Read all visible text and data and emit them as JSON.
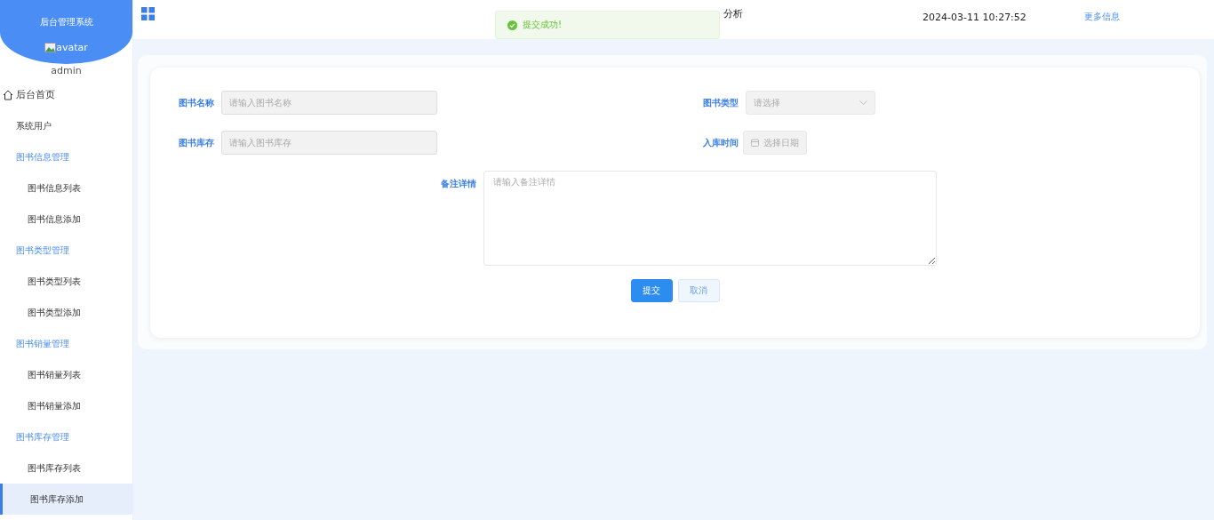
{
  "sidebar": {
    "title": "后台管理系统",
    "avatar_alt": "avatar",
    "username": "admin",
    "items": [
      {
        "label": "后台首页",
        "kind": "home",
        "selected": false
      },
      {
        "label": "系统用户",
        "kind": "plain",
        "selected": false
      },
      {
        "label": "图书信息管理",
        "kind": "group",
        "selected": false
      },
      {
        "label": "图书信息列表",
        "kind": "sub",
        "selected": false
      },
      {
        "label": "图书信息添加",
        "kind": "sub",
        "selected": false
      },
      {
        "label": "图书类型管理",
        "kind": "group",
        "selected": false
      },
      {
        "label": "图书类型列表",
        "kind": "sub",
        "selected": false
      },
      {
        "label": "图书类型添加",
        "kind": "sub",
        "selected": false
      },
      {
        "label": "图书销量管理",
        "kind": "group",
        "selected": false
      },
      {
        "label": "图书销量列表",
        "kind": "sub",
        "selected": false
      },
      {
        "label": "图书销量添加",
        "kind": "sub",
        "selected": false
      },
      {
        "label": "图书库存管理",
        "kind": "group",
        "selected": false
      },
      {
        "label": "图书库存列表",
        "kind": "sub",
        "selected": false
      },
      {
        "label": "图书库存添加",
        "kind": "sub",
        "selected": true
      }
    ]
  },
  "header": {
    "title": "分析",
    "datetime": "2024-03-11 10:27:52",
    "more_link": "更多信息"
  },
  "toast": {
    "message": "提交成功!"
  },
  "form": {
    "fields": [
      {
        "label": "图书名称",
        "kind": "text",
        "placeholder": "请输入图书名称"
      },
      {
        "label": "图书类型",
        "kind": "select",
        "placeholder": "请选择"
      },
      {
        "label": "图书库存",
        "kind": "text",
        "placeholder": "请输入图书库存"
      },
      {
        "label": "入库时间",
        "kind": "date",
        "placeholder": "选择日期"
      },
      {
        "label": "备注详情",
        "kind": "textarea",
        "placeholder": "请输入备注详情"
      }
    ],
    "buttons": [
      {
        "label": "提交",
        "kind": "primary"
      },
      {
        "label": "取消",
        "kind": "plain"
      }
    ]
  }
}
